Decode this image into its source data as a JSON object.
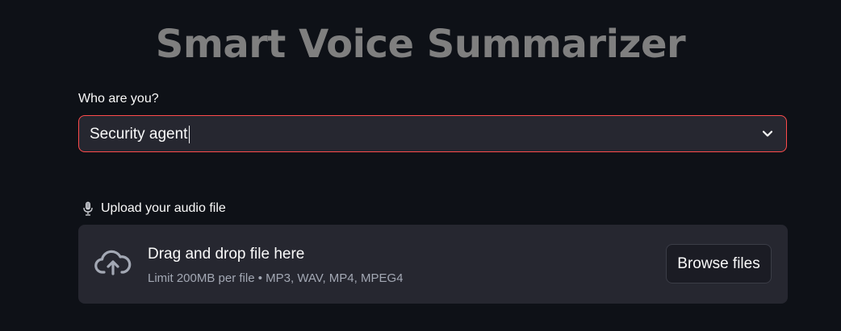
{
  "app": {
    "title": "Smart Voice Summarizer"
  },
  "role_select": {
    "label": "Who are you?",
    "value": "Security agent",
    "icon": "chevron-down-icon"
  },
  "upload": {
    "label": "Upload your audio file",
    "label_icon": "microphone-icon",
    "dropzone_title": "Drag and drop file here",
    "dropzone_limit": "Limit 200MB per file • MP3, WAV, MP4, MPEG4",
    "dropzone_icon": "cloud-upload-icon",
    "browse_button": "Browse files"
  },
  "colors": {
    "background": "#0e1117",
    "widget_bg": "#262730",
    "focus_border": "#ff4b4b",
    "title": "#7f7f7f",
    "muted_text": "#a3a8b4"
  }
}
